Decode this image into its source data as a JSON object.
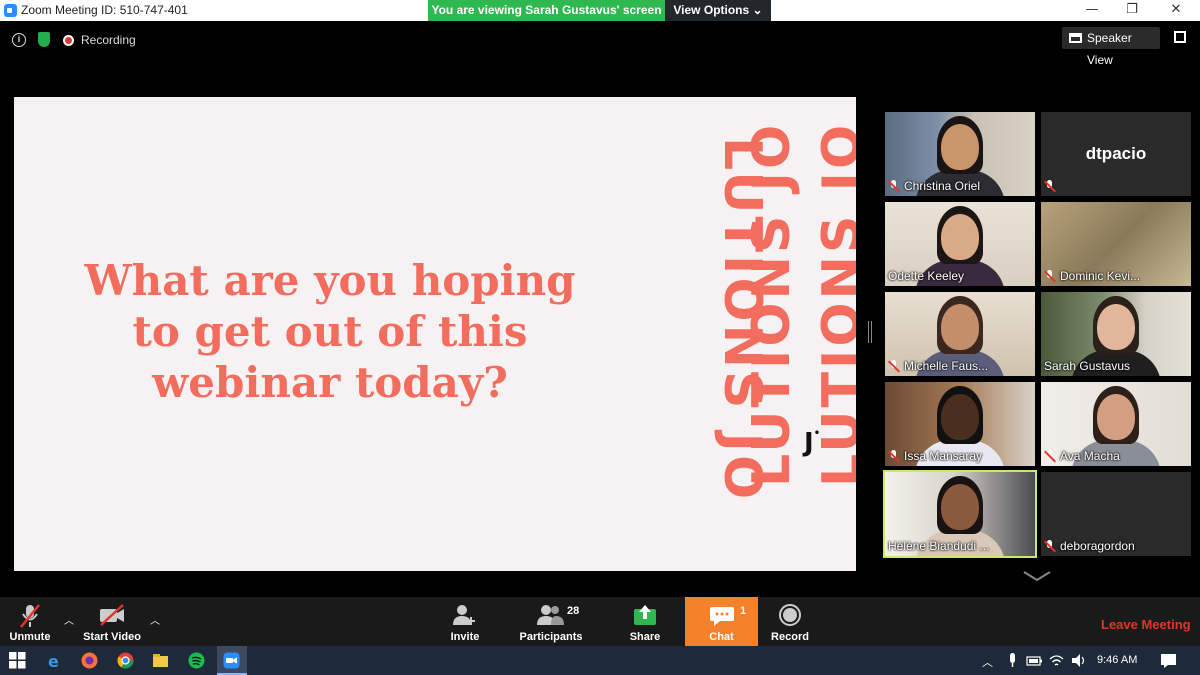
{
  "window": {
    "title": "Zoom Meeting ID: 510-747-401",
    "share_banner": "You are viewing Sarah Gustavus' screen",
    "view_options": "View Options",
    "minimize": "—",
    "maximize": "❐",
    "close": "✕"
  },
  "meeting": {
    "recording_label": "Recording",
    "speaker_view_label": "Speaker View"
  },
  "slide": {
    "question": "What are you hoping to get out of this webinar today?",
    "band_word_1": "LUTIONS JO",
    "band_word_2": "LUTIONS JO",
    "band_word_3": "LUTIONS JO",
    "logo": "J"
  },
  "gallery": [
    {
      "name": "Christina Oriel",
      "muted": true,
      "video": true
    },
    {
      "name": "dtpacio",
      "muted": true,
      "video": false
    },
    {
      "name": "Odette Keeley",
      "muted": false,
      "video": true
    },
    {
      "name": "Dominic Kevi...",
      "muted": true,
      "video": true
    },
    {
      "name": "Michelle Faus...",
      "muted": true,
      "video": true
    },
    {
      "name": "Sarah Gustavus",
      "muted": false,
      "video": true
    },
    {
      "name": "Issa Mansaray",
      "muted": true,
      "video": true
    },
    {
      "name": "Ava Macha",
      "muted": true,
      "video": true
    },
    {
      "name": "Hélène Biandudi ...",
      "muted": false,
      "video": true,
      "active": true
    },
    {
      "name": "deboragordon",
      "muted": true,
      "video": false
    }
  ],
  "toolbar": {
    "unmute": "Unmute",
    "start_video": "Start Video",
    "invite": "Invite",
    "participants": "Participants",
    "participants_count": "28",
    "share": "Share",
    "chat": "Chat",
    "chat_count": "1",
    "record": "Record",
    "leave": "Leave Meeting"
  },
  "taskbar": {
    "time": "9:46 AM",
    "icons": [
      "windows-start-icon",
      "edge-icon",
      "firefox-icon",
      "chrome-icon",
      "file-explorer-icon",
      "spotify-icon",
      "zoom-icon"
    ]
  },
  "colors": {
    "slide_accent": "#f26d5e",
    "share_banner": "#2fb84f",
    "chat_active": "#f5812a",
    "leave_red": "#e0352b",
    "active_speaker": "#c8e866"
  }
}
